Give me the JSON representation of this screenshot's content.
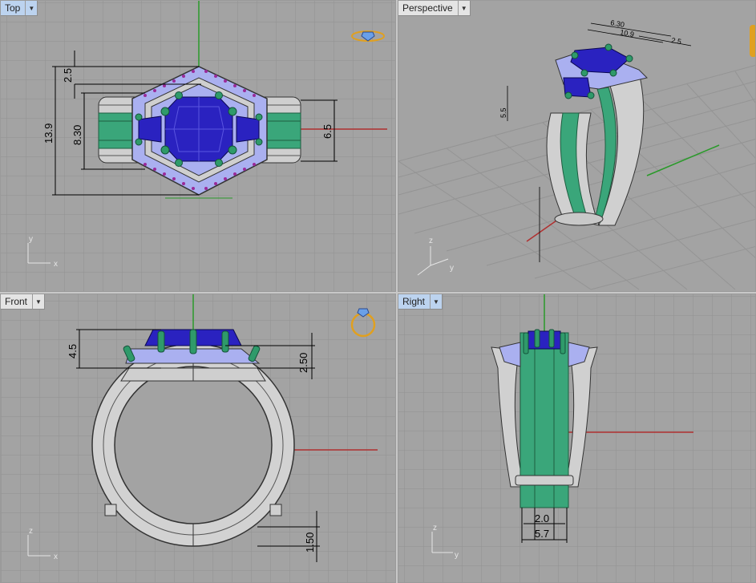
{
  "viewports": {
    "top": {
      "title": "Top"
    },
    "perspective": {
      "title": "Perspective"
    },
    "front": {
      "title": "Front"
    },
    "right": {
      "title": "Right"
    }
  },
  "axes": {
    "x": "x",
    "y": "y",
    "z": "z"
  },
  "dimensions": {
    "top": {
      "d1": "2.5",
      "d2": "13.9",
      "d3": "8.30",
      "d4": "6.5"
    },
    "perspective": {
      "d1": "6.30",
      "d2": "10.9",
      "d3": "2.5",
      "d4": "5.5"
    },
    "front": {
      "d1": "4.5",
      "d2": "2.50",
      "d3": "1.50"
    },
    "right": {
      "d1": "2.0",
      "d2": "5.7"
    }
  },
  "colors": {
    "viewport_bg": "#a3a3a3",
    "grid": "#8f8f8f",
    "x_axis": "#b03030",
    "y_axis": "#2a9a2a",
    "gem_blue": "#2a22c0",
    "prong_green": "#2f9a6a",
    "pave_lilac": "#aab0f0",
    "metal": "#d2d2d2"
  },
  "icons": {
    "top_widget": "ring-top-icon",
    "front_widget": "ring-front-icon"
  }
}
